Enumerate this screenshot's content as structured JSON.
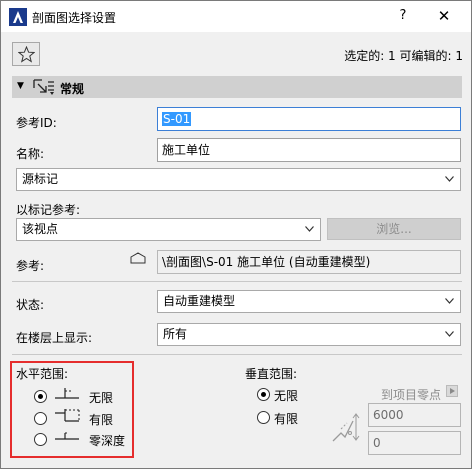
{
  "window": {
    "title": "剖面图选择设置",
    "help": "?",
    "close": "✕"
  },
  "header": {
    "selection_info": "选定的: 1 可编辑的: 1"
  },
  "section": {
    "label": "常规"
  },
  "general": {
    "ref_id_label": "参考ID:",
    "ref_id_value": "S-01",
    "name_label": "名称:",
    "name_value": "施工单位",
    "source_marker": "源标记",
    "ref_to_marker_label": "以标记参考:",
    "ref_to_marker_value": "该视点",
    "browse_button": "浏览...",
    "reference_label": "参考:",
    "reference_value": "\\剖面图\\S-01 施工单位 (自动重建模型)",
    "status_label": "状态:",
    "status_value": "自动重建模型",
    "show_on_stories_label": "在楼层上显示:",
    "show_on_stories_value": "所有"
  },
  "horizontal_range": {
    "label": "水平范围:",
    "options": [
      "无限",
      "有限",
      "零深度"
    ],
    "selected": 0
  },
  "vertical_range": {
    "label": "垂直范围:",
    "options": [
      "无限",
      "有限"
    ],
    "selected": 0,
    "to_project_zero": "到项目零点",
    "top_value": "6000",
    "bottom_value": "0"
  },
  "colors": {
    "highlight_border": "#e52d2d",
    "selection": "#3399ff"
  }
}
